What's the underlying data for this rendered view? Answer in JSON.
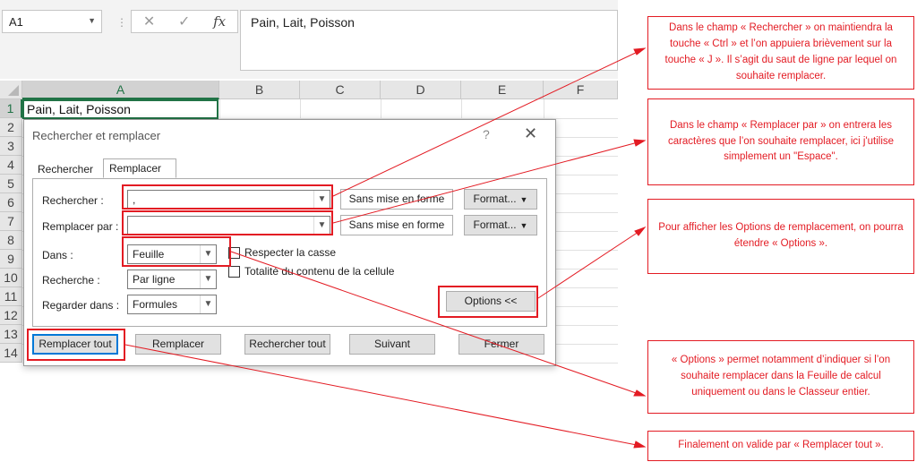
{
  "formula_bar": {
    "name_box": "A1",
    "cancel_icon": "✕",
    "enter_icon": "✓",
    "fx_label": "fx",
    "content": "Pain, Lait, Poisson"
  },
  "sheet": {
    "columns": [
      "A",
      "B",
      "C",
      "D",
      "E",
      "F"
    ],
    "rows": [
      "1",
      "2",
      "3",
      "4",
      "5",
      "6",
      "7",
      "8",
      "9",
      "10",
      "11",
      "12",
      "13",
      "14"
    ],
    "cell_a1": "Pain, Lait, Poisson"
  },
  "dialog": {
    "title": "Rechercher et remplacer",
    "help": "?",
    "close": "✕",
    "tabs": [
      "Rechercher",
      "Remplacer"
    ],
    "find_label": "Rechercher :",
    "find_value": ",",
    "replace_label": "Remplacer par :",
    "replace_value": "",
    "no_format_1": "Sans mise en forme",
    "no_format_2": "Sans mise en forme",
    "format_1": "Format...",
    "format_2": "Format...",
    "within_label": "Dans :",
    "within_value": "Feuille",
    "search_label": "Recherche :",
    "search_value": "Par ligne",
    "look_in_label": "Regarder dans :",
    "look_in_value": "Formules",
    "match_case": "Respecter la casse",
    "entire_cell": "Totalité du contenu de la cellule",
    "options_button": "Options <<",
    "replace_all": "Remplacer tout",
    "replace": "Remplacer",
    "find_all": "Rechercher tout",
    "find_next": "Suivant",
    "close_button": "Fermer"
  },
  "callouts": {
    "c1": "Dans le champ « Rechercher » on maintiendra la touche « Ctrl » et l’on appuiera brièvement sur la touche « J ». Il s’agit du saut de ligne par lequel on souhaite remplacer.",
    "c2": "Dans le champ « Remplacer par » on entrera les caractères que l’on souhaite remplacer, ici j'utilise simplement un \"Espace\".",
    "c3": "Pour afficher les Options de remplacement, on pourra étendre « Options ».",
    "c4": "« Options » permet notamment d’indiquer si l’on souhaite remplacer dans la Feuille de calcul uniquement ou dans le Classeur entier.",
    "c5": "Finalement on valide par « Remplacer tout »."
  },
  "colors": {
    "annotation_red": "#e31b23",
    "excel_green": "#217346",
    "focus_blue": "#0078d7"
  }
}
